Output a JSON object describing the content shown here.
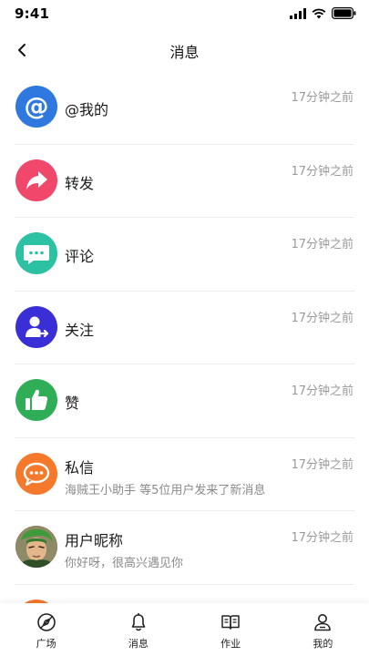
{
  "status_bar": {
    "time": "9:41"
  },
  "nav": {
    "title": "消息"
  },
  "colors": {
    "mention": "#2e78e0",
    "forward": "#f0476a",
    "comment": "#2cc1a2",
    "follow": "#3a2fd6",
    "like": "#2fae57",
    "dm": "#f5792a"
  },
  "messages": [
    {
      "title": "@我的",
      "time": "17分钟之前",
      "icon": "at-icon"
    },
    {
      "title": "转发",
      "time": "17分钟之前",
      "icon": "share-arrow-icon"
    },
    {
      "title": "评论",
      "time": "17分钟之前",
      "icon": "comment-bubble-icon"
    },
    {
      "title": "关注",
      "time": "17分钟之前",
      "icon": "user-follow-icon"
    },
    {
      "title": "赞",
      "time": "17分钟之前",
      "icon": "thumbs-up-icon"
    },
    {
      "title": "私信",
      "subtitle": "海贼王小助手 等5位用户发来了新消息",
      "time": "17分钟之前",
      "icon": "chat-bubble-icon"
    },
    {
      "title": "用户昵称",
      "subtitle": "你好呀，很高兴遇见你",
      "time": "17分钟之前",
      "icon": "user-avatar"
    }
  ],
  "tabs": [
    {
      "label": "广场",
      "icon": "compass-icon"
    },
    {
      "label": "消息",
      "icon": "bell-icon"
    },
    {
      "label": "作业",
      "icon": "book-icon"
    },
    {
      "label": "我的",
      "icon": "profile-icon"
    }
  ]
}
